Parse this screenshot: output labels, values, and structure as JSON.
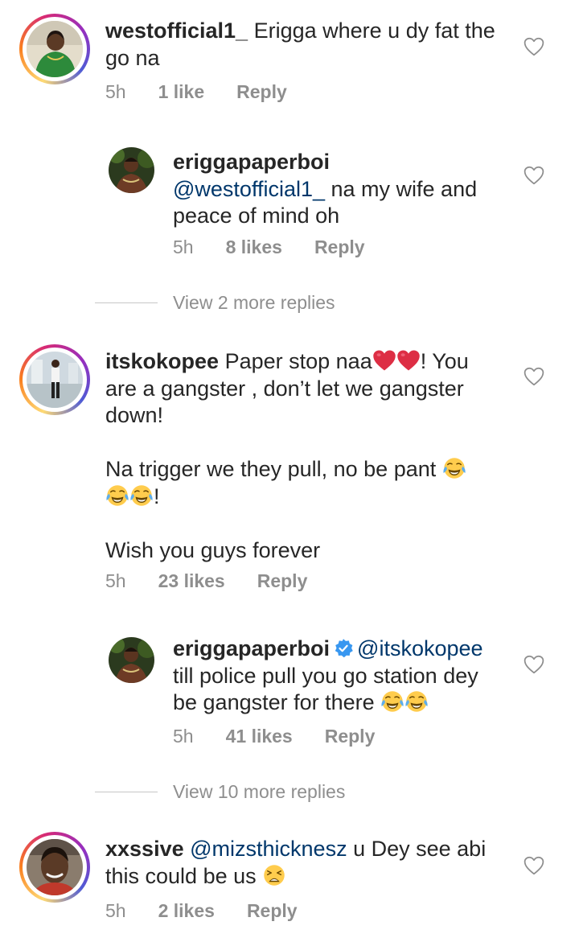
{
  "comments": [
    {
      "username": "westofficial1_",
      "text_line1": "Erigga where u dy fat the",
      "text_line2": "go na",
      "time": "5h",
      "likes": "1 like",
      "reply": "Reply"
    },
    {
      "username": "eriggapaperboi",
      "mention": "@westofficial1_",
      "text_after_mention": "na my wife and",
      "text_line3": "peace of mind oh",
      "time": "5h",
      "likes": "8 likes",
      "reply": "Reply"
    },
    {
      "username": "itskokopee",
      "text_line1_a": "Paper stop naa",
      "text_line1_b": "! You",
      "text_line2": "are a gangster , don’t let we gangster",
      "text_line3": "down!",
      "text_line4": "Na trigger we they pull, no be pant",
      "text_line5_end": "!",
      "text_line6": "Wish you guys forever",
      "time": "5h",
      "likes": "23 likes",
      "reply": "Reply"
    },
    {
      "username": "eriggapaperboi",
      "mention": "@itskokopee",
      "text_line2": "till police pull you go station dey",
      "text_line3": "be gangster for there",
      "time": "5h",
      "likes": "41 likes",
      "reply": "Reply"
    },
    {
      "username": "xxssive",
      "mention": "@mizsthicknesz",
      "text_after_mention": "u Dey see abi",
      "text_line2": "this could be us",
      "time": "5h",
      "likes": "2 likes",
      "reply": "Reply"
    }
  ],
  "view_more": [
    {
      "label": "View 2 more replies"
    },
    {
      "label": "View 10 more replies"
    }
  ],
  "icons": {
    "heart": "heart-outline-icon",
    "red_heart": "red-heart-emoji",
    "laughing": "face-with-tears-of-joy-emoji",
    "weary": "weary-face-emoji",
    "verified": "verified-badge-icon"
  },
  "colors": {
    "username": "#262626",
    "mention": "#00376b",
    "meta": "#8e8e8e",
    "verified": "#3897f0"
  }
}
